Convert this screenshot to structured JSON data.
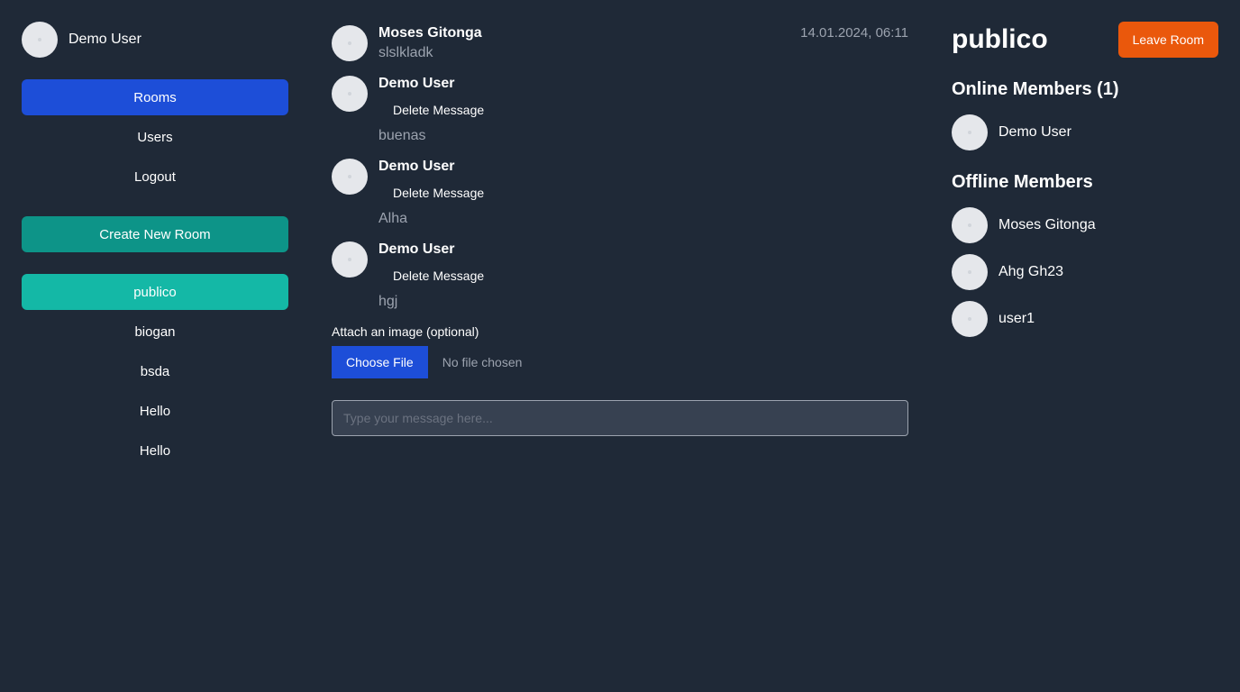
{
  "sidebar": {
    "user_name": "Demo User",
    "nav": {
      "rooms": "Rooms",
      "users": "Users",
      "logout": "Logout"
    },
    "create_room": "Create New Room",
    "rooms": [
      "publico",
      "biogan",
      "bsda",
      "Hello",
      "Hello"
    ]
  },
  "chat": {
    "messages": [
      {
        "author": "Moses Gitonga",
        "time": "14.01.2024, 06:11",
        "text": "slslkladk",
        "delete_label": ""
      },
      {
        "author": "Demo User",
        "time": "",
        "text": "buenas",
        "delete_label": "Delete Message"
      },
      {
        "author": "Demo User",
        "time": "",
        "text": "Alha",
        "delete_label": "Delete Message"
      },
      {
        "author": "Demo User",
        "time": "",
        "text": "hgj",
        "delete_label": "Delete Message"
      }
    ],
    "attach_label": "Attach an image (optional)",
    "choose_file": "Choose File",
    "file_status": "No file chosen",
    "input_placeholder": "Type your message here..."
  },
  "room": {
    "title": "publico",
    "leave_button": "Leave Room",
    "online_title": "Online Members (1)",
    "online_members": [
      "Demo User"
    ],
    "offline_title": "Offline Members",
    "offline_members": [
      "Moses Gitonga",
      "Ahg Gh23",
      "user1"
    ]
  },
  "colors": {
    "background": "#1f2937",
    "primary": "#1d4ed8",
    "teal": "#0d9488",
    "active_room": "#14b8a6",
    "leave": "#ea580c"
  }
}
